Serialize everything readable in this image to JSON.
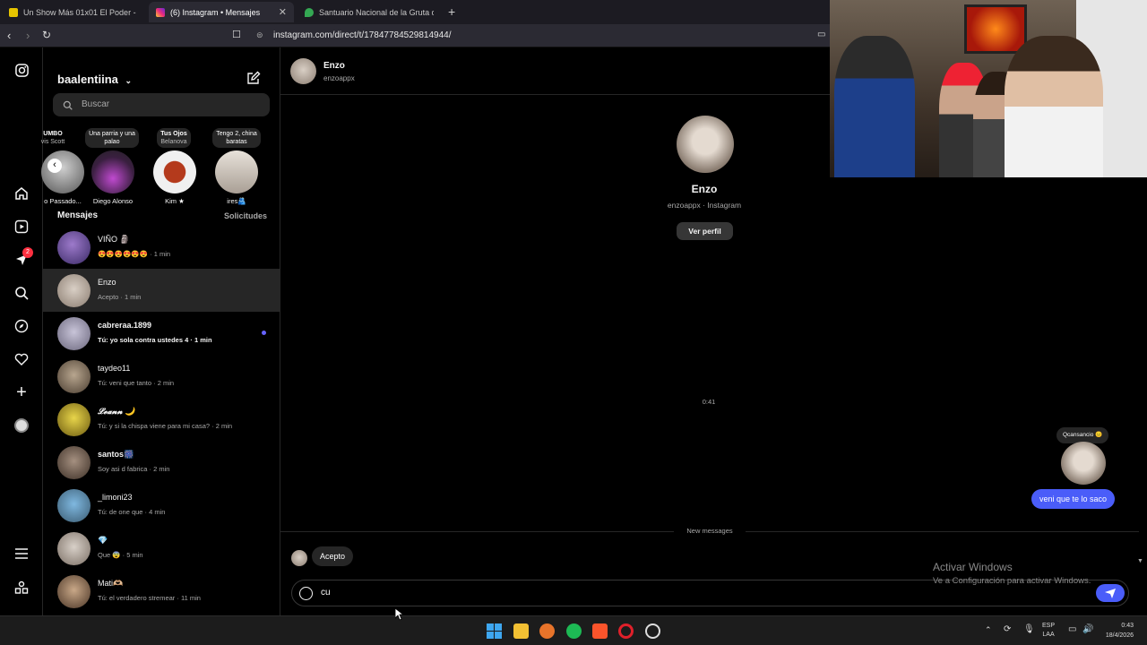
{
  "browser": {
    "tabs": [
      {
        "title": "Un Show Más 01x01 El Poder - Mis C",
        "active": false
      },
      {
        "title": "(6) Instagram • Mensajes",
        "active": true
      },
      {
        "title": "Santuario Nacional de la Gruta de Lo",
        "active": false
      }
    ],
    "new_tab": "+",
    "url": "instagram.com/direct/t/17847784529814944/"
  },
  "sidebar_badge": "2",
  "list": {
    "username": "baalentiina",
    "search_placeholder": "Buscar",
    "notes": [
      {
        "line1": "UMBO",
        "line2": "vis Scott"
      },
      {
        "line1": "Una parria y una",
        "line2": "palao"
      },
      {
        "line1": "Tus Ojos",
        "line2": "Belanova"
      },
      {
        "line1": "Tengo 2, china",
        "line2": "baratas"
      }
    ],
    "stories": [
      {
        "name": "o Passado..."
      },
      {
        "name": "Diego Alonso"
      },
      {
        "name": "Kim ★"
      },
      {
        "name": "ires🫂"
      }
    ],
    "messages_label": "Mensajes",
    "requests_label": "Solicitudes",
    "conversations": [
      {
        "name": "VIÑO 🗿",
        "preview": "😍😍😍😍😍😍 · 1 min",
        "unread": false
      },
      {
        "name": "Enzo",
        "preview": "Acepto · 1 min",
        "unread": false
      },
      {
        "name": "cabreraa.1899",
        "preview": "Tú: yo sola contra ustedes 4 · 1 min",
        "unread": true
      },
      {
        "name": "taydeo11",
        "preview": "Tú: veni que tanto · 2 min",
        "unread": false
      },
      {
        "name": "𝓛𝓮𝓪𝓷𝓷 🌙",
        "preview": "Tú: y si la chispa viene para mi casa? · 2 min",
        "unread": false
      },
      {
        "name": "santos🎆",
        "preview": "Soy asi d fabrica · 2 min",
        "unread": false
      },
      {
        "name": "_limoni23",
        "preview": "Tú: de one que · 4 min",
        "unread": false
      },
      {
        "name": "💎",
        "preview": "Que 😨 · 5 min",
        "unread": false
      },
      {
        "name": "Mati🫶🏼",
        "preview": "Tú: el verdadero stremear · 11 min",
        "unread": false
      }
    ]
  },
  "chat": {
    "header_name": "Enzo",
    "header_handle": "enzoappx",
    "profile_name": "Enzo",
    "profile_sub": "enzoappx · Instagram",
    "view_profile": "Ver perfil",
    "time_divider": "0:41",
    "reply_note": "Qcansancio 😐",
    "sent_message": "veni que te lo saco",
    "new_messages": "New messages",
    "received_message": "Acepto",
    "composer_value": "cu"
  },
  "watermark": {
    "title": "Activar Windows",
    "sub": "Ve a Configuración para activar Windows."
  },
  "taskbar": {
    "lang1": "ESP",
    "lang2": "LAA",
    "time": "0:43",
    "date": "18/4/2026"
  },
  "colors": {
    "accent": "#4a5df9",
    "unread_dot": "#6663ff",
    "bg": "#000000"
  }
}
